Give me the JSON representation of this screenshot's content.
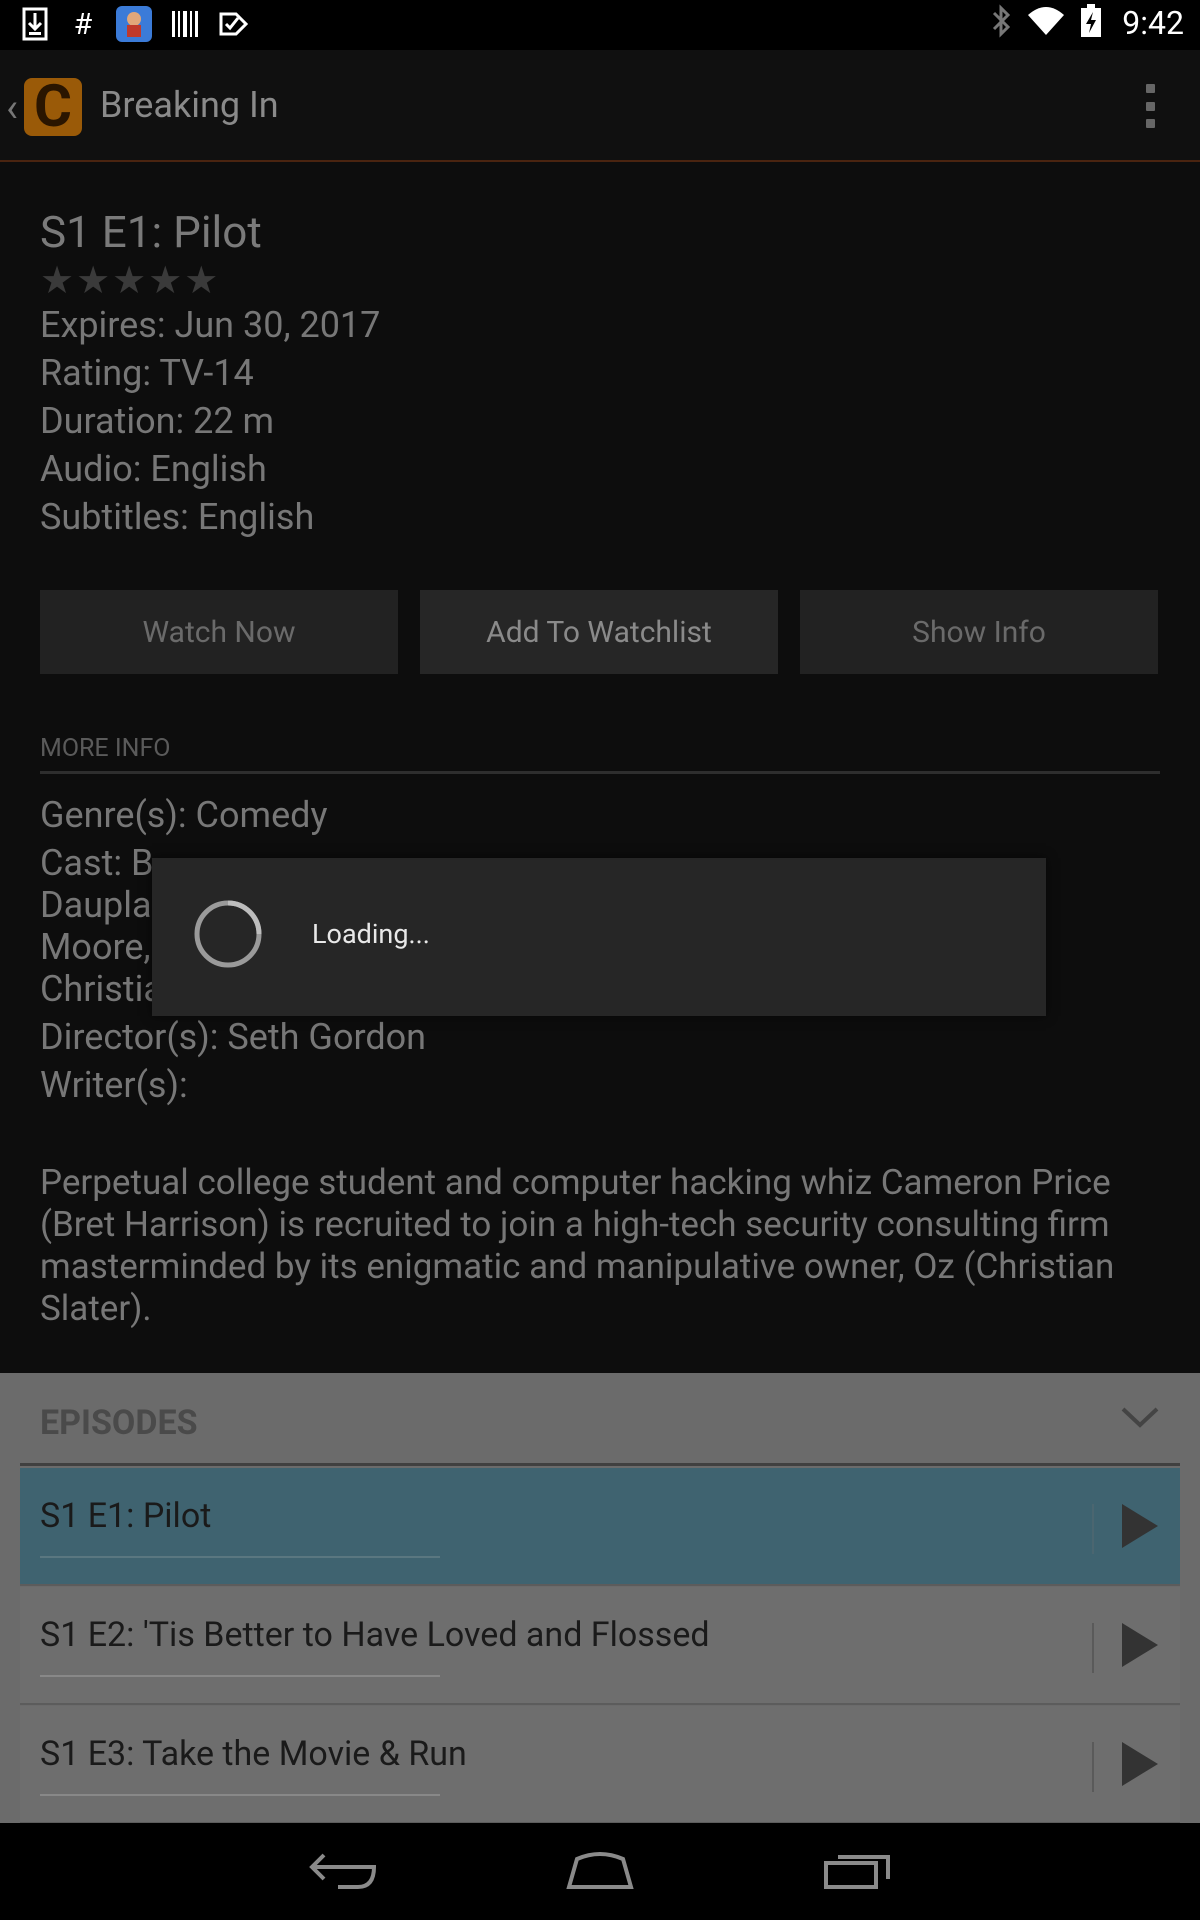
{
  "status_bar": {
    "time": "9:42",
    "left_icons": [
      "download-icon",
      "hashtag-icon",
      "app-notification-icon",
      "barcode-icon",
      "check-icon"
    ],
    "right_icons": [
      "bluetooth-icon",
      "wifi-icon",
      "battery-icon"
    ]
  },
  "action_bar": {
    "title": "Breaking In",
    "logo_letter": "C"
  },
  "episode": {
    "title": "S1 E1: Pilot",
    "stars": "★★★★★",
    "rating_stars": 0,
    "expires": "Expires: Jun 30, 2017",
    "rating": "Rating: TV-14",
    "duration": "Duration: 22 m",
    "audio": "Audio: English",
    "subtitles": "Subtitles: English"
  },
  "buttons": {
    "watch_now": "Watch Now",
    "add_to_watchlist": "Add To Watchlist",
    "show_info": "Show Info"
  },
  "more_info": {
    "label": "MORE INFO",
    "genre": "Genre(s): Comedy",
    "cast_line1": "Cast: B",
    "cast_line2": "Daupla",
    "cast_line3": "Moore,",
    "cast_line4": "Christia",
    "director": "Director(s): Seth Gordon",
    "writer": "Writer(s):",
    "synopsis": "Perpetual college student and computer hacking whiz Cameron Price (Bret Harrison) is recruited to join a high-tech security consulting firm masterminded by its enigmatic and manipulative owner, Oz (Christian Slater)."
  },
  "episodes": {
    "header": "EPISODES",
    "items": [
      {
        "title": "S1 E1: Pilot",
        "selected": true
      },
      {
        "title": "S1 E2: 'Tis Better to Have Loved and Flossed",
        "selected": false
      },
      {
        "title": "S1 E3: Take the Movie & Run",
        "selected": false
      }
    ]
  },
  "dialog": {
    "text": "Loading..."
  }
}
